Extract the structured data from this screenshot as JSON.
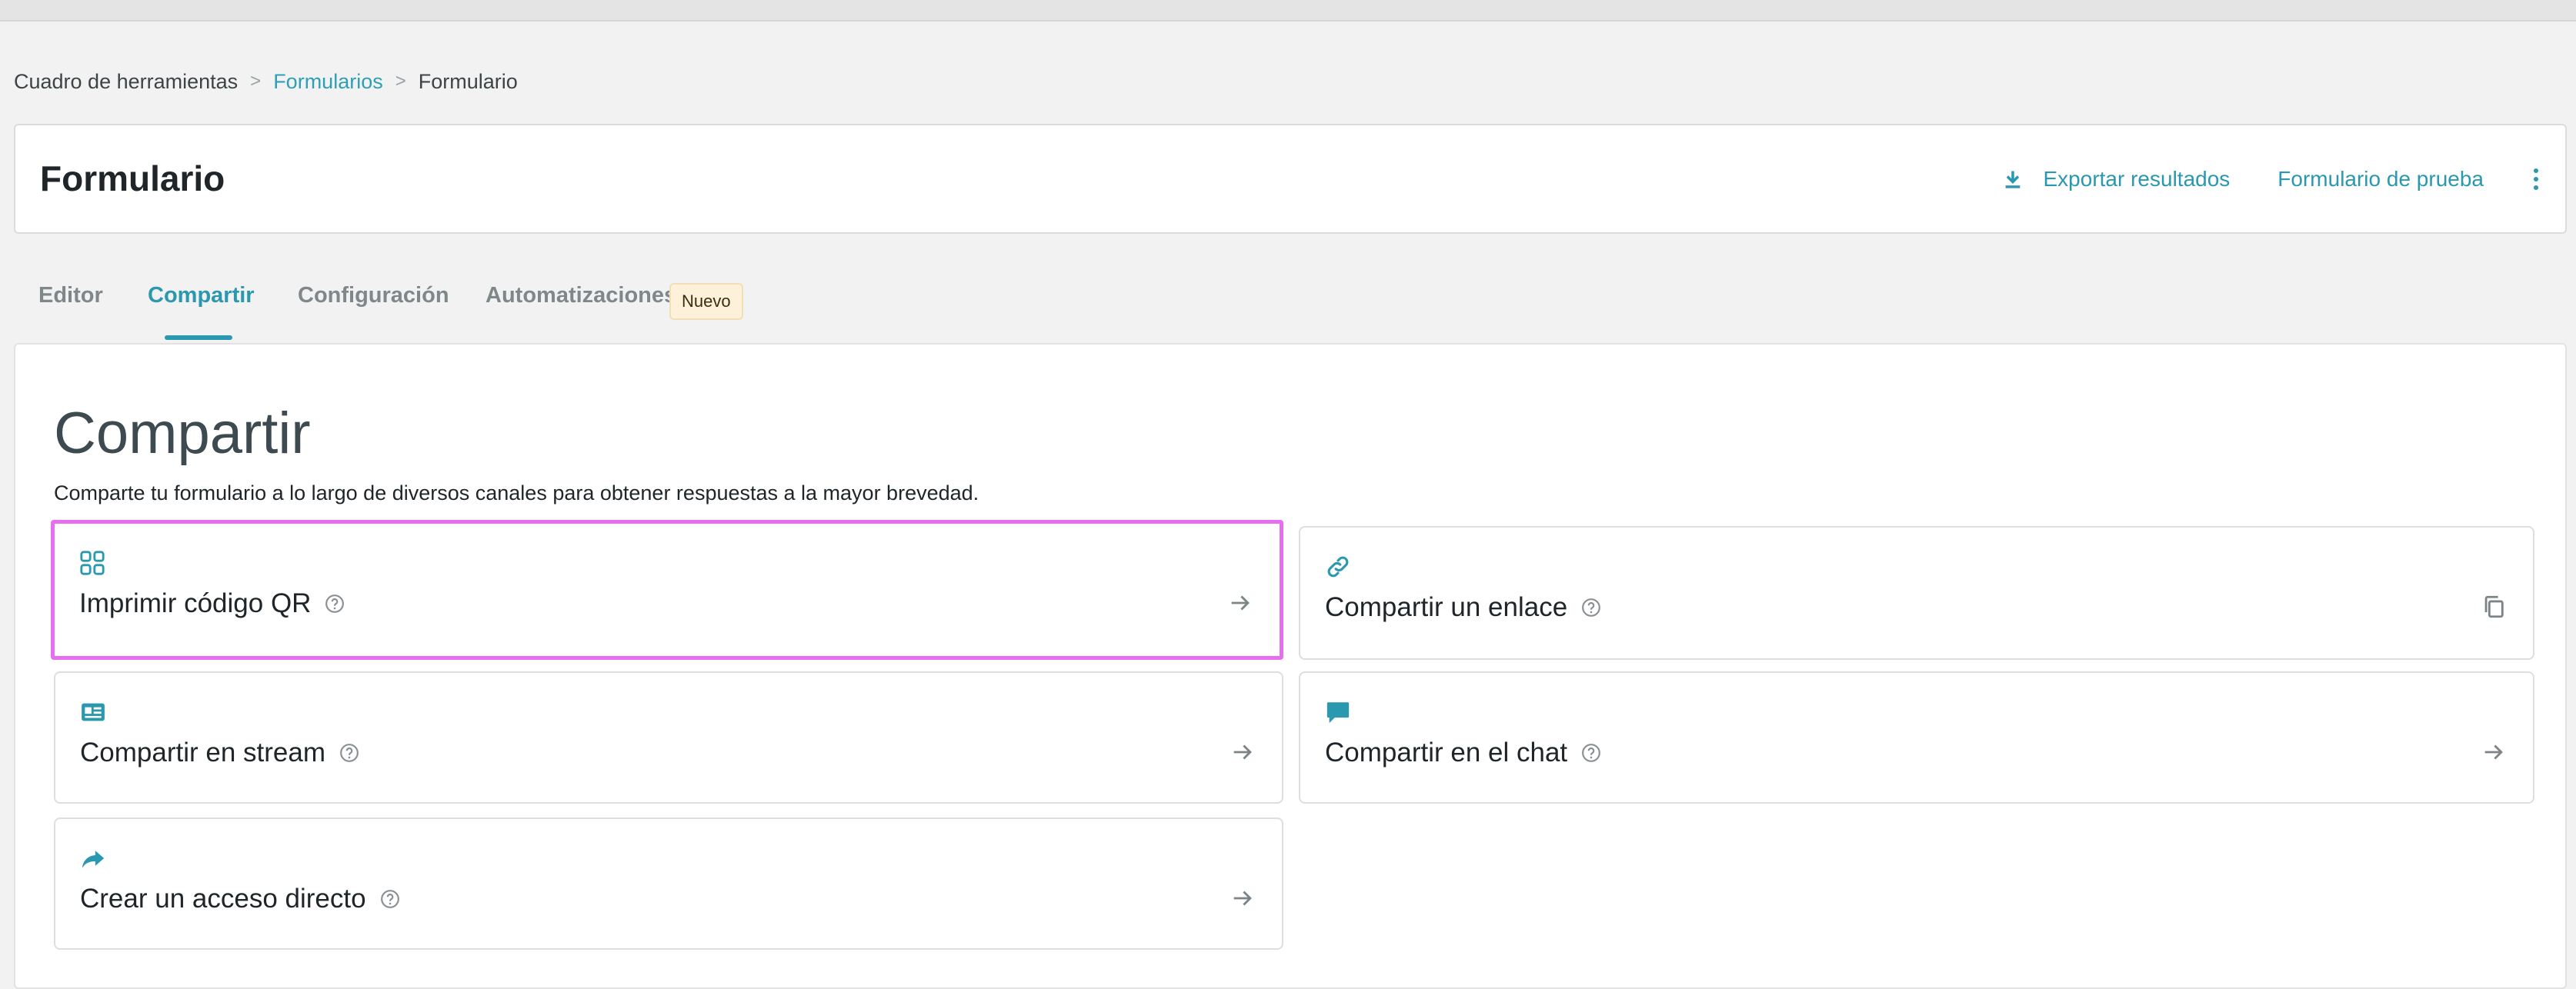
{
  "breadcrumb": {
    "item1": "Cuadro de herramientas",
    "item2": "Formularios",
    "item3": "Formulario",
    "separator": ">"
  },
  "header": {
    "title": "Formulario",
    "export_label": "Exportar resultados",
    "test_label": "Formulario de prueba"
  },
  "tabs": {
    "editor": "Editor",
    "share": "Compartir",
    "settings": "Configuración",
    "automations": "Automatizaciones",
    "new_badge": "Nuevo"
  },
  "share": {
    "title": "Compartir",
    "description": "Comparte tu formulario a lo largo de diversos canales para obtener respuestas a la mayor brevedad.",
    "qr_label": "Imprimir código QR",
    "link_label": "Compartir un enlace",
    "stream_label": "Compartir en stream",
    "chat_label": "Compartir en el chat",
    "shortcut_label": "Crear un acceso directo"
  },
  "colors": {
    "accent": "#2a98ae",
    "highlight": "#e86ef0",
    "badge_bg": "#fdf1d9"
  },
  "icons": {
    "qr": "qr-grid-icon",
    "link": "link-icon",
    "stream": "stream-card-icon",
    "chat": "chat-bubble-icon",
    "shortcut": "share-arrow-icon",
    "help": "help-circle-icon",
    "arrow": "arrow-right-icon",
    "copy": "copy-icon",
    "download": "download-icon",
    "more": "more-vertical-icon"
  }
}
